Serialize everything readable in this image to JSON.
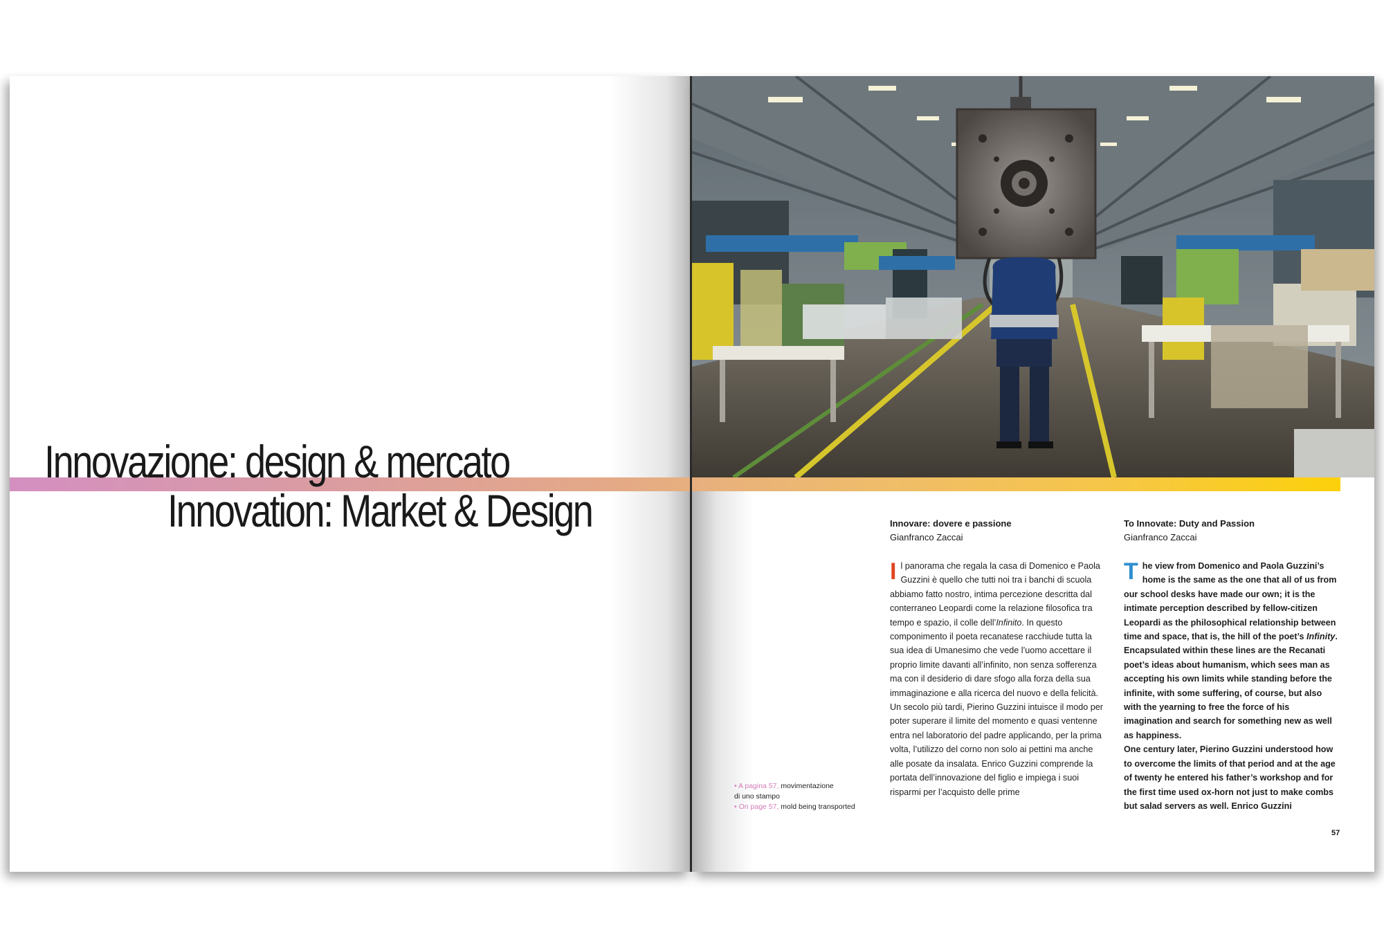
{
  "titles": {
    "italian": "Innovazione: design & mercato",
    "english": "Innovation: Market & Design"
  },
  "article_it": {
    "heading": "Innovare: dovere e passione",
    "author": "Gianfranco Zaccai",
    "dropcap": "I",
    "dropcap_color": "#e0441f",
    "body_start": "l panorama che regala la casa di Domenico e Paola Guzzini è quello che tutti noi tra i banchi di scuola abbiamo fatto nostro, intima percezione descritta dal conterraneo Leopardi come la relazione filosofica tra tempo e spazio, il colle dell’",
    "body_italic": "Infinito",
    "body_rest": ". In questo componimento il poeta recanatese racchiude tutta la sua idea di Umanesimo che vede l’uomo accettare il proprio limite davanti all’infinito, non senza sofferenza ma con il desiderio di dare sfogo alla forza della sua immaginazione e alla ricerca del nuovo e della felicità.",
    "body_p2": "Un secolo più tardi, Pierino Guzzini intuisce il modo per poter superare il limite del momento e quasi ventenne entra nel laboratorio del padre applicando, per la prima volta, l’utilizzo del corno non solo ai pettini ma anche alle posate da insalata. Enrico Guzzini comprende la portata dell’innovazione del figlio e impiega i suoi risparmi per l’acquisto delle prime"
  },
  "article_en": {
    "heading": "To Innovate: Duty and Passion",
    "author": "Gianfranco Zaccai",
    "dropcap": "T",
    "dropcap_color": "#2f8fd0",
    "body_start": "he view from Domenico and Paola Guzzini’s home is the same as the one that all of us from our school desks have made our own; it is the intimate perception described by fellow-citizen Leopardi as the philosophical relationship between time and space, that is, the hill of the poet’s ",
    "body_italic": "Infinity",
    "body_rest": ". Encapsulated within these lines are the Recanati poet’s ideas about humanism, which sees man as accepting his own limits while standing before the infinite, with some suffering, of course, but also with the yearning to free the force of his imagination and search for something new as well as happiness.",
    "body_p2": "One century later, Pierino Guzzini understood how to overcome the limits of that period and at the age of twenty he entered his father’s workshop and for the first time used ox-horn not just to make combs but salad servers as well. Enrico Guzzini"
  },
  "caption": {
    "it_marker": "• A pagina 57,",
    "it_text_1": " movimentazione",
    "it_text_2": "di uno stampo",
    "en_marker": "• On page 57,",
    "en_text": " mold being transported"
  },
  "page_number": "57",
  "colors": {
    "band_start": "#d48fc1",
    "band_end": "#fcd10a",
    "caption_pink": "#d37bb8"
  }
}
